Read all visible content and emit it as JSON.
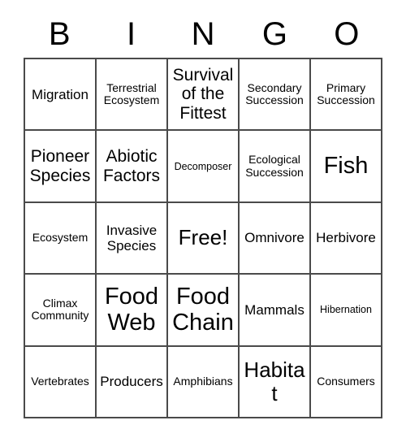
{
  "header": {
    "letters": [
      "B",
      "I",
      "N",
      "G",
      "O"
    ]
  },
  "grid": {
    "columns": 5,
    "rows": 5,
    "border_color": "#4a4a4a",
    "background_color": "#ffffff",
    "text_color": "#000000",
    "cells": [
      {
        "text": "Migration",
        "size": "md"
      },
      {
        "text": "Terrestrial Ecosystem",
        "size": "sm"
      },
      {
        "text": "Survival of the Fittest",
        "size": "lg"
      },
      {
        "text": "Secondary Succession",
        "size": "sm"
      },
      {
        "text": "Primary Succession",
        "size": "sm"
      },
      {
        "text": "Pioneer Species",
        "size": "lg"
      },
      {
        "text": "Abiotic Factors",
        "size": "lg"
      },
      {
        "text": "Decomposer",
        "size": "xs"
      },
      {
        "text": "Ecological Succession",
        "size": "sm"
      },
      {
        "text": "Fish",
        "size": "xxl"
      },
      {
        "text": "Ecosystem",
        "size": "sm"
      },
      {
        "text": "Invasive Species",
        "size": "md"
      },
      {
        "text": "Free!",
        "size": "xl"
      },
      {
        "text": "Omnivore",
        "size": "md"
      },
      {
        "text": "Herbivore",
        "size": "md"
      },
      {
        "text": "Climax Community",
        "size": "sm"
      },
      {
        "text": "Food Web",
        "size": "xxl"
      },
      {
        "text": "Food Chain",
        "size": "xxl"
      },
      {
        "text": "Mammals",
        "size": "md"
      },
      {
        "text": "Hibernation",
        "size": "xs"
      },
      {
        "text": "Vertebrates",
        "size": "sm"
      },
      {
        "text": "Producers",
        "size": "md"
      },
      {
        "text": "Amphibians",
        "size": "sm"
      },
      {
        "text": "Habitat",
        "size": "xl"
      },
      {
        "text": "Consumers",
        "size": "sm"
      }
    ]
  }
}
